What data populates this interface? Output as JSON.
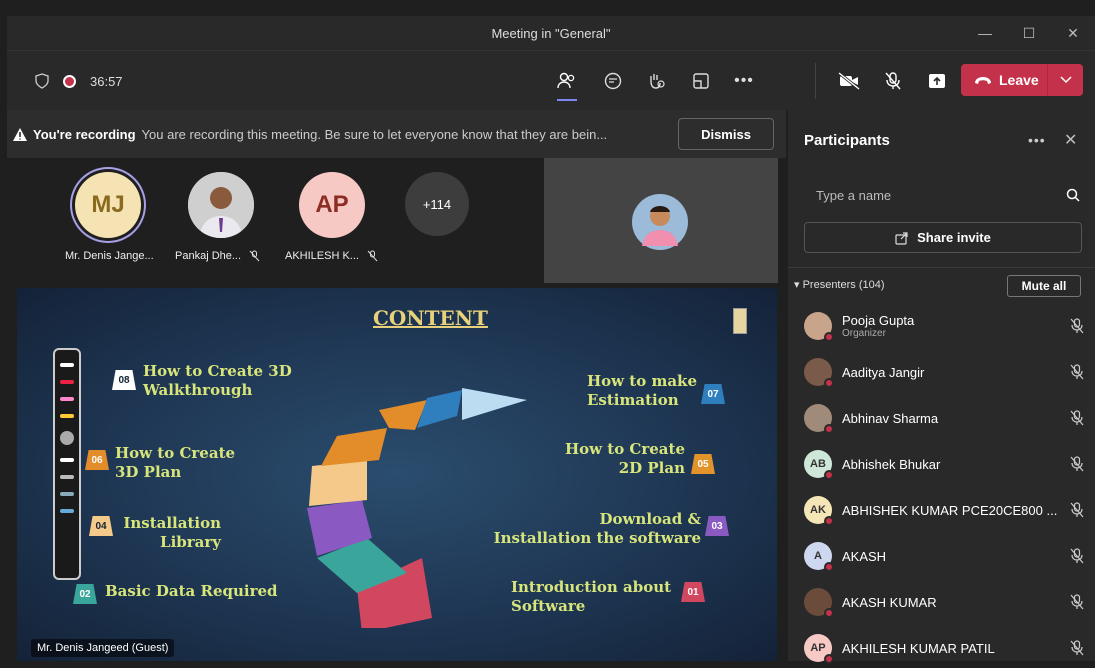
{
  "window": {
    "title": "Meeting in \"General\""
  },
  "toolbar": {
    "timer": "36:57",
    "leave_label": "Leave"
  },
  "banner": {
    "title": "You're recording",
    "text": "You are recording this meeting. Be sure to let everyone know that they are bein...",
    "dismiss": "Dismiss"
  },
  "tiles": [
    {
      "initials": "MJ",
      "name": "Mr. Denis Jange...",
      "bg": "#f5e3b3",
      "color": "#8a6a1f"
    },
    {
      "initials": "",
      "name": "Pankaj Dhe...",
      "bg": "#d9d9d9",
      "color": "#333"
    },
    {
      "initials": "AP",
      "name": "AKHILESH K...",
      "bg": "#f7c9c4",
      "color": "#8b2d24"
    }
  ],
  "overflow": "+114",
  "slide": {
    "title": "CONTENT",
    "items": [
      {
        "num": "08",
        "text": "How to Create 3D\nWalkthrough",
        "color": "#ffffff"
      },
      {
        "num": "06",
        "text": "How to Create\n3D Plan",
        "color": "#e28c2a"
      },
      {
        "num": "04",
        "text": "Installation\nLibrary",
        "color": "#f5c98a"
      },
      {
        "num": "02",
        "text": "Basic Data Required",
        "color": "#3aa59a"
      },
      {
        "num": "07",
        "text": "How to make\nEstimation",
        "color": "#2f7fbf"
      },
      {
        "num": "05",
        "text": "How to Create\n2D Plan",
        "color": "#e2932a"
      },
      {
        "num": "03",
        "text": "Download &\nInstallation the software",
        "color": "#8a5ac2"
      },
      {
        "num": "01",
        "text": "Introduction about\nSoftware",
        "color": "#d24760"
      }
    ],
    "speaker": "Mr. Denis Jangeed (Guest)"
  },
  "panel": {
    "title": "Participants",
    "search_placeholder": "Type a name",
    "share": "Share invite",
    "presenters": "Presenters (104)",
    "mute_all": "Mute all",
    "people": [
      {
        "name": "Pooja Gupta",
        "role": "Organizer",
        "initials": "",
        "bg": "#c7a48a"
      },
      {
        "name": "Aaditya Jangir",
        "role": "",
        "initials": "",
        "bg": "#7a5a48"
      },
      {
        "name": "Abhinav Sharma",
        "role": "",
        "initials": "",
        "bg": "#a08a7a"
      },
      {
        "name": "Abhishek Bhukar",
        "role": "",
        "initials": "AB",
        "bg": "#cfe7d9"
      },
      {
        "name": "ABHISHEK KUMAR PCE20CE800 ...",
        "role": "",
        "initials": "AK",
        "bg": "#f5e6b8"
      },
      {
        "name": "AKASH",
        "role": "",
        "initials": "A",
        "bg": "#cdd7ef"
      },
      {
        "name": "AKASH KUMAR",
        "role": "",
        "initials": "",
        "bg": "#6b4b3a"
      },
      {
        "name": "AKHILESH KUMAR PATIL",
        "role": "",
        "initials": "AP",
        "bg": "#f7c9c4"
      }
    ]
  }
}
